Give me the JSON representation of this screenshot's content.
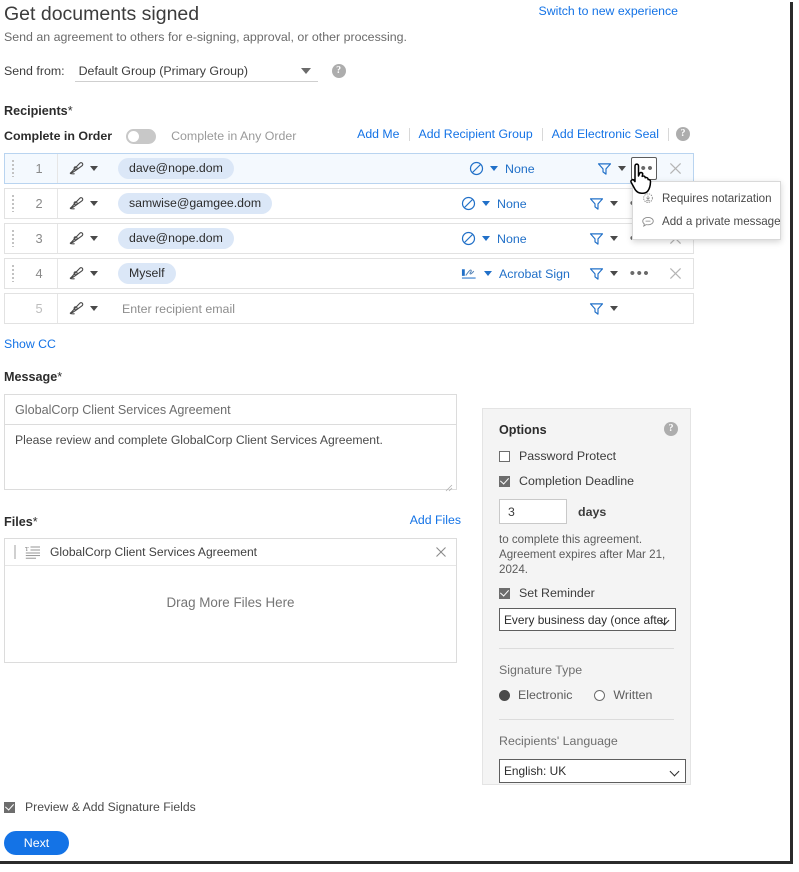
{
  "header": {
    "title": "Get documents signed",
    "subtitle": "Send an agreement to others for e-signing, approval, or other processing.",
    "switch_link": "Switch to new experience"
  },
  "send_from": {
    "label": "Send from:",
    "value": "Default Group (Primary Group)",
    "help_icon": "help-icon"
  },
  "recipients": {
    "section_label": "Recipients",
    "required_mark": "*",
    "complete_in_order_label": "Complete in Order",
    "complete_in_any_order_label": "Complete in Any Order",
    "toggle_state": "off",
    "actions": [
      {
        "label": "Add Me"
      },
      {
        "label": "Add Recipient Group"
      },
      {
        "label": "Add Electronic Seal"
      }
    ],
    "rows": [
      {
        "num": "1",
        "email": "dave@nope.dom",
        "role_icon": "signature-pen-icon",
        "auth": "None",
        "auth_icon": "no-auth-icon",
        "active": true
      },
      {
        "num": "2",
        "email": "samwise@gamgee.dom",
        "role_icon": "signature-pen-icon",
        "auth": "None",
        "auth_icon": "no-auth-icon",
        "active": false
      },
      {
        "num": "3",
        "email": "dave@nope.dom",
        "role_icon": "signature-pen-icon",
        "auth": "None",
        "auth_icon": "no-auth-icon",
        "active": false
      },
      {
        "num": "4",
        "email": "Myself",
        "role_icon": "signature-pen-icon",
        "auth": "Acrobat Sign",
        "auth_icon": "acrobat-sign-icon",
        "active": false
      }
    ],
    "empty_row": {
      "num": "5",
      "placeholder": "Enter recipient email"
    },
    "show_cc": "Show CC"
  },
  "context_menu": {
    "items": [
      {
        "label": "Requires notarization",
        "icon": "notary-seal-icon"
      },
      {
        "label": "Add a private message",
        "icon": "chat-bubble-icon"
      }
    ]
  },
  "message": {
    "section_label": "Message",
    "required_mark": "*",
    "subject": "GlobalCorp Client Services Agreement",
    "body": "Please review and complete GlobalCorp Client Services Agreement."
  },
  "files": {
    "section_label": "Files",
    "required_mark": "*",
    "add_files": "Add Files",
    "items": [
      {
        "name": "GlobalCorp Client Services Agreement",
        "icon": "document-icon"
      }
    ],
    "drop_text": "Drag More Files Here"
  },
  "options": {
    "title": "Options",
    "help_icon": "help-icon",
    "password_protect": {
      "label": "Password Protect",
      "checked": false
    },
    "completion_deadline": {
      "label": "Completion Deadline",
      "checked": true
    },
    "days_value": "3",
    "days_label": "days",
    "note_line1": "to complete this agreement.",
    "note_line2": "Agreement expires after Mar 21, 2024.",
    "set_reminder": {
      "label": "Set Reminder",
      "checked": true
    },
    "reminder_value": "Every business day (once after",
    "signature_type_label": "Signature Type",
    "signature_options": [
      {
        "label": "Electronic",
        "selected": true
      },
      {
        "label": "Written",
        "selected": false
      }
    ],
    "language_label": "Recipients' Language",
    "language_value": "English: UK"
  },
  "footer": {
    "preview_label": "Preview & Add Signature Fields",
    "preview_checked": true,
    "next_label": "Next"
  },
  "colors": {
    "accent": "#1473e6",
    "link": "#1473e6",
    "chip_bg": "#dbe7f7",
    "panel_bg": "#f4f4f4"
  }
}
